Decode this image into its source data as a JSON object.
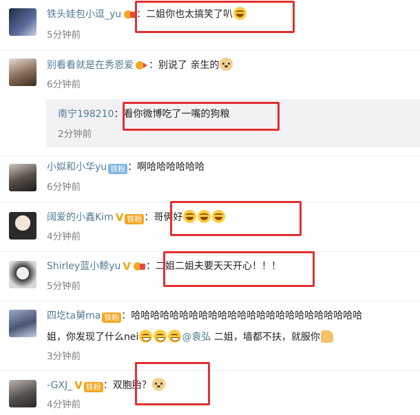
{
  "comments": [
    {
      "user": "铁头娃包小逗_yu",
      "colon": "：",
      "text": "二姐你也太搞笑了叭",
      "emoji": "laughing-tears-emoji",
      "time": "5分钟前"
    },
    {
      "user": "别看看就是在秀恩爱",
      "colon": "：",
      "text": "别说了 亲生的",
      "emoji": "doge-emoji",
      "time": "6分钟前"
    },
    {
      "user": "小姒和小华yu",
      "fan_badge": "铁粉",
      "colon": "：",
      "text": "啊哈哈哈哈哈哈",
      "time": "6分钟前"
    },
    {
      "user": "阔爱的小鑫Kim",
      "fan_badge": "铁粉",
      "colon": "：",
      "text": "哥俩好",
      "emoji": "laughing-tears-emoji",
      "time": "4分钟前"
    },
    {
      "user": "Shirley蓝小鲸yu",
      "colon": "：",
      "text": "二姐二姐夫要天天开心！！！",
      "time": "5分钟前"
    },
    {
      "user": "四圪ta舅ma",
      "fan_badge": "铁粉",
      "colon": "：",
      "text_line1": "哈哈哈哈哈哈哈哈哈哈哈哈哈哈哈哈哈哈哈哈哈哈哈哈",
      "text_line2a": "姐，你发现了什么nei",
      "mention": "@袁弘",
      "text_line2b": " 二姐，墙都不扶，就服你",
      "time": "3分钟前"
    },
    {
      "user": "-GXJ_",
      "fan_badge": "铁粉",
      "colon": "：",
      "text": "双胞胎？",
      "emoji": "doge-emoji",
      "time": "4分钟前"
    }
  ],
  "reply": {
    "user": "南宁198210",
    "colon": "：",
    "text": "看你微博吃了一嘴的狗粮",
    "time": "2分钟前"
  },
  "colors": {
    "username": "#507a96",
    "highlight_box": "#e03030",
    "time": "#808080"
  }
}
